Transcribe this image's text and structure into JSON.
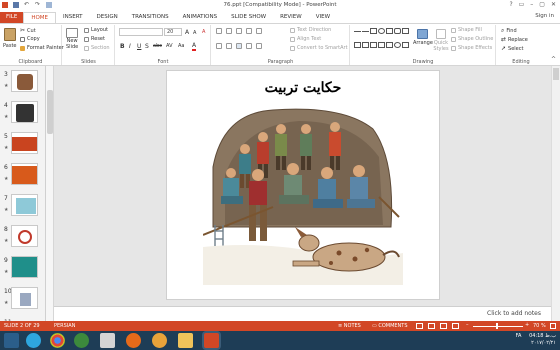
{
  "window": {
    "title": "76.ppt [Compatibility Mode] - PowerPoint",
    "controls": [
      "?",
      "▭",
      "–",
      "▢",
      "✕"
    ]
  },
  "tabs": [
    "FILE",
    "HOME",
    "INSERT",
    "DESIGN",
    "TRANSITIONS",
    "ANIMATIONS",
    "SLIDE SHOW",
    "REVIEW",
    "VIEW"
  ],
  "signin": "Sign in",
  "ribbon": {
    "clipboard": {
      "paste": "Paste",
      "cut": "Cut",
      "copy": "Copy",
      "format_painter": "Format Painter",
      "label": "Clipboard"
    },
    "slides": {
      "new_slide": "New",
      "new_slide2": "Slide",
      "layout": "Layout",
      "reset": "Reset",
      "section": "Section",
      "label": "Slides"
    },
    "font": {
      "size": "20",
      "bold": "B",
      "italic": "I",
      "underline": "U",
      "shadow": "S",
      "strike": "abc",
      "spacing": "AV",
      "case": "Aa",
      "clear": "A",
      "color": "A",
      "grow": "A",
      "shrink": "A",
      "label": "Font"
    },
    "paragraph": {
      "text_direction": "Text Direction",
      "align_text": "Align Text",
      "smartart": "Convert to SmartArt",
      "label": "Paragraph"
    },
    "drawing": {
      "arrange": "Arrange",
      "quick_styles": "Quick Styles",
      "shape_fill": "Shape Fill",
      "shape_outline": "Shape Outline",
      "shape_effects": "Shape Effects",
      "label": "Drawing"
    },
    "editing": {
      "find": "Find",
      "replace": "Replace",
      "select": "Select",
      "label": "Editing"
    }
  },
  "thumbnails": [
    {
      "num": "3",
      "star": "★"
    },
    {
      "num": "4",
      "star": "★"
    },
    {
      "num": "5",
      "star": "★"
    },
    {
      "num": "6",
      "star": "★"
    },
    {
      "num": "7",
      "star": "★"
    },
    {
      "num": "8",
      "star": "★"
    },
    {
      "num": "9",
      "star": "★"
    },
    {
      "num": "10",
      "star": "★"
    },
    {
      "num": "11",
      "star": ""
    }
  ],
  "slide": {
    "title": "حکایت تربیت"
  },
  "notes": {
    "placeholder": "Click to add notes"
  },
  "statusbar": {
    "slide_info": "SLIDE 2 OF 29",
    "language": "PERSIAN",
    "notes": "NOTES",
    "comments": "COMMENTS",
    "zoom": "70 %"
  },
  "taskbar": {
    "lang": "FA",
    "time": "04:18 ب.ظ",
    "date": "۲۰۱۷/۰۲/۲۱"
  },
  "colors": {
    "accent": "#d24726",
    "taskbar": "#1e3d56"
  }
}
